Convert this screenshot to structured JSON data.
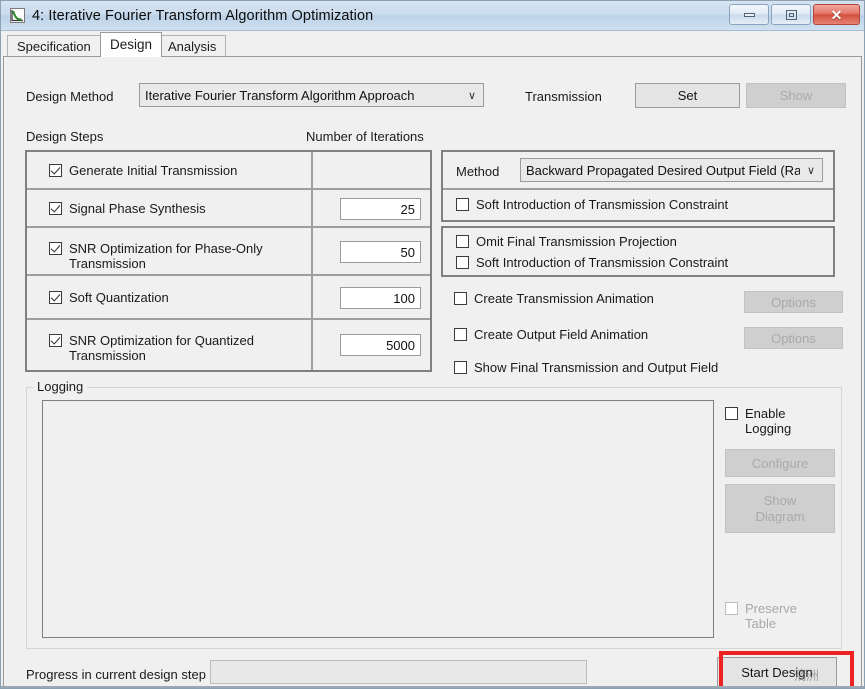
{
  "window": {
    "title": "4: Iterative Fourier Transform Algorithm Optimization",
    "icon": "chart-curve-icon",
    "buttons": {
      "minimize": "minimize-icon",
      "maximize": "maximize-icon",
      "close": "✕"
    }
  },
  "tabs": [
    {
      "label": "Specification",
      "active": false
    },
    {
      "label": "Design",
      "active": true
    },
    {
      "label": "Analysis",
      "active": false
    }
  ],
  "design_method": {
    "label": "Design Method",
    "value": "Iterative Fourier Transform Algorithm Approach",
    "arrow": "∨"
  },
  "transmission": {
    "label": "Transmission",
    "set_button": "Set",
    "show_button": "Show"
  },
  "headers": {
    "design_steps": "Design Steps",
    "number_of_iterations": "Number of Iterations"
  },
  "steps": [
    {
      "label": "Generate Initial Transmission",
      "checked": true,
      "iterations": ""
    },
    {
      "label": "Signal Phase Synthesis",
      "checked": true,
      "iterations": "25"
    },
    {
      "label": "SNR Optimization for Phase-Only\nTransmission",
      "checked": true,
      "iterations": "50"
    },
    {
      "label": "Soft Quantization",
      "checked": true,
      "iterations": "100"
    },
    {
      "label": "SNR Optimization for Quantized\nTransmission",
      "checked": true,
      "iterations": "5000"
    }
  ],
  "method": {
    "label": "Method",
    "value": "Backward Propagated Desired Output Field (Ra",
    "arrow": "∨"
  },
  "options_group_a": [
    {
      "label": "Soft Introduction of Transmission Constraint",
      "checked": false
    }
  ],
  "options_group_b": [
    {
      "label": "Omit Final Transmission Projection",
      "checked": false
    },
    {
      "label": "Soft Introduction of Transmission Constraint",
      "checked": false
    }
  ],
  "animations": [
    {
      "label": "Create Transmission Animation",
      "checked": false,
      "button": "Options",
      "button_disabled": true
    },
    {
      "label": "Create Output Field Animation",
      "checked": false,
      "button": "Options",
      "button_disabled": true
    },
    {
      "label": "Show Final Transmission and Output Field",
      "checked": false,
      "button": null,
      "button_disabled": false
    }
  ],
  "logging": {
    "title": "Logging",
    "text": "",
    "enable_label": "Enable\nLogging",
    "enable_checked": false,
    "configure_button": "Configure",
    "show_diagram_button": "Show\nDiagram",
    "preserve_label": "Preserve\nTable",
    "preserve_checked": false
  },
  "footer": {
    "progress_label": "Progress in current design step",
    "progress_value": "",
    "start_button": "Start Design",
    "watermark": "清洲"
  },
  "colors": {
    "highlight": "#ee2222",
    "face": "#f0f0f0",
    "border": "#808080"
  }
}
